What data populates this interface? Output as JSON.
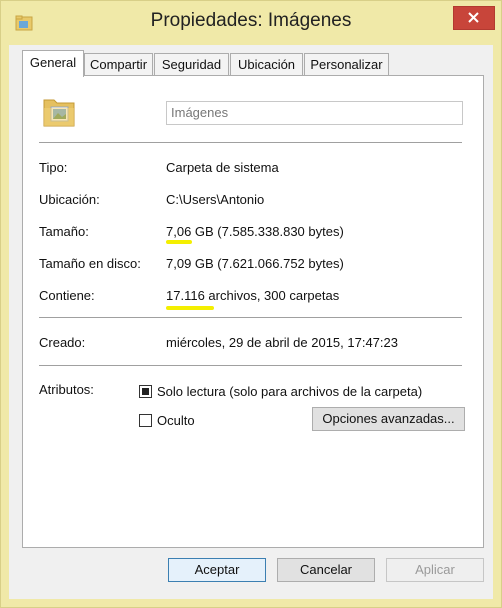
{
  "window": {
    "title": "Propiedades: Imágenes"
  },
  "tabs": [
    {
      "label": "General",
      "active": true
    },
    {
      "label": "Compartir",
      "active": false
    },
    {
      "label": "Seguridad",
      "active": false
    },
    {
      "label": "Ubicación",
      "active": false
    },
    {
      "label": "Personalizar",
      "active": false
    }
  ],
  "general": {
    "name_value": "Imágenes",
    "rows": [
      {
        "label": "Tipo:",
        "value": "Carpeta de sistema"
      },
      {
        "label": "Ubicación:",
        "value": "C:\\Users\\Antonio"
      },
      {
        "label": "Tamaño:",
        "value": "7,06 GB (7.585.338.830 bytes)"
      },
      {
        "label": "Tamaño en disco:",
        "value": "7,09 GB (7.621.066.752 bytes)"
      },
      {
        "label": "Contiene:",
        "value": "17.116 archivos, 300 carpetas"
      }
    ],
    "created": {
      "label": "Creado:",
      "value": "miércoles, 29 de abril de 2015, 17:47:23"
    },
    "attributes": {
      "label": "Atributos:",
      "readonly": {
        "label": "Solo lectura (solo para archivos de la carpeta)",
        "state": "indeterminate"
      },
      "hidden": {
        "label": "Oculto",
        "checked": false
      },
      "advanced_button": "Opciones avanzadas..."
    }
  },
  "buttons": {
    "ok": "Aceptar",
    "cancel": "Cancelar",
    "apply": "Aplicar"
  },
  "colors": {
    "highlight": "#f4ef00",
    "close": "#c8453a",
    "frame": "#f0e9a8"
  }
}
